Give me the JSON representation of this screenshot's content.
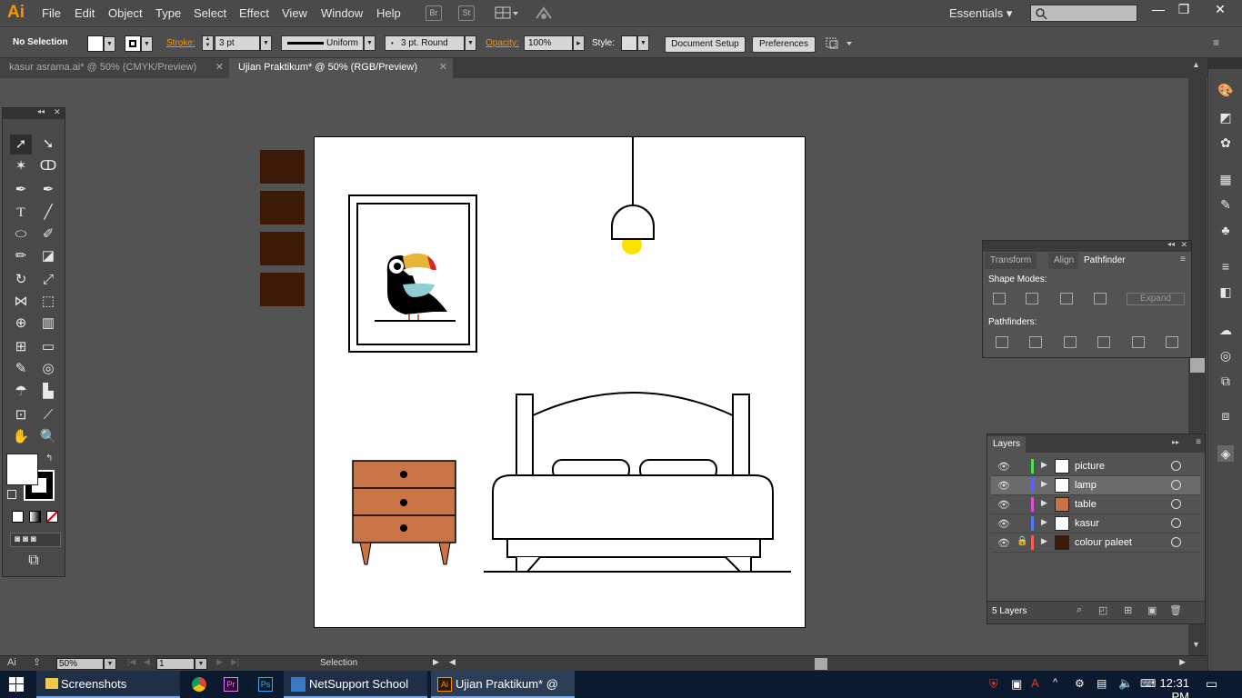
{
  "app": {
    "logo": "Ai"
  },
  "menu": [
    "File",
    "Edit",
    "Object",
    "Type",
    "Select",
    "Effect",
    "View",
    "Window",
    "Help"
  ],
  "toolbar_buttons": {
    "bridge": "Br",
    "stock": "St"
  },
  "workspace": {
    "label": "Essentials ▾",
    "search_placeholder": ""
  },
  "window_controls": {
    "minimize": "—",
    "restore": "❐",
    "close": "✕"
  },
  "control_bar": {
    "selection_label": "No Selection",
    "stroke_label": "Stroke:",
    "stroke_weight": "3 pt",
    "stroke_profile": "Uniform",
    "brush": "3 pt. Round",
    "brush_bullet": "•",
    "opacity_label": "Opacity:",
    "opacity_value": "100%",
    "style_label": "Style:",
    "document_setup": "Document Setup",
    "preferences": "Preferences"
  },
  "tabs": [
    {
      "label": "kasur asrama.ai* @ 50% (CMYK/Preview)",
      "active": false
    },
    {
      "label": "Ujian Praktikum* @ 50% (RGB/Preview)",
      "active": true
    }
  ],
  "tab_close": "✕",
  "colors": {
    "swatch_dark_brown": "#3b1b06",
    "drawer": "#c97447",
    "toucan_beak": "#e8b43a",
    "toucan_red": "#d9262c",
    "toucan_chest": "#8ecfd3",
    "lamp_bulb": "#ffe100",
    "ai_orange": "#f79500"
  },
  "pathfinder_panel": {
    "tabs": [
      "Transform",
      "Align",
      "Pathfinder"
    ],
    "shape_modes_label": "Shape Modes:",
    "expand_label": "Expand",
    "pathfinders_label": "Pathfinders:"
  },
  "layers_panel": {
    "tab": "Layers",
    "layers": [
      {
        "name": "picture",
        "color": "#4de04d",
        "locked": false,
        "selected": false
      },
      {
        "name": "lamp",
        "color": "#5a63ff",
        "locked": false,
        "selected": true
      },
      {
        "name": "table",
        "color": "#e24bde",
        "locked": false,
        "selected": false
      },
      {
        "name": "kasur",
        "color": "#4a7dff",
        "locked": false,
        "selected": false
      },
      {
        "name": "colour paleet",
        "color": "#ff5a4f",
        "locked": true,
        "selected": false
      }
    ],
    "count_label": "5 Layers"
  },
  "status_bar": {
    "zoom": "50%",
    "artboard_number": "1",
    "tool_name": "Selection"
  },
  "taskbar": {
    "items": [
      {
        "label": "Screenshots",
        "icon": "folder-icon"
      },
      {
        "label": "",
        "icon": "chrome-icon"
      },
      {
        "label": "",
        "icon": "premiere-icon"
      },
      {
        "label": "",
        "icon": "photoshop-icon"
      },
      {
        "label": "NetSupport School Cl...",
        "icon": "netsupport-icon"
      },
      {
        "label": "Ujian Praktikum* @ 5...",
        "icon": "illustrator-icon"
      }
    ],
    "clock": "12:31 PM",
    "premiere_glyph": "Pr",
    "photoshop_glyph": "Ps",
    "illustrator_glyph": "Ai"
  }
}
